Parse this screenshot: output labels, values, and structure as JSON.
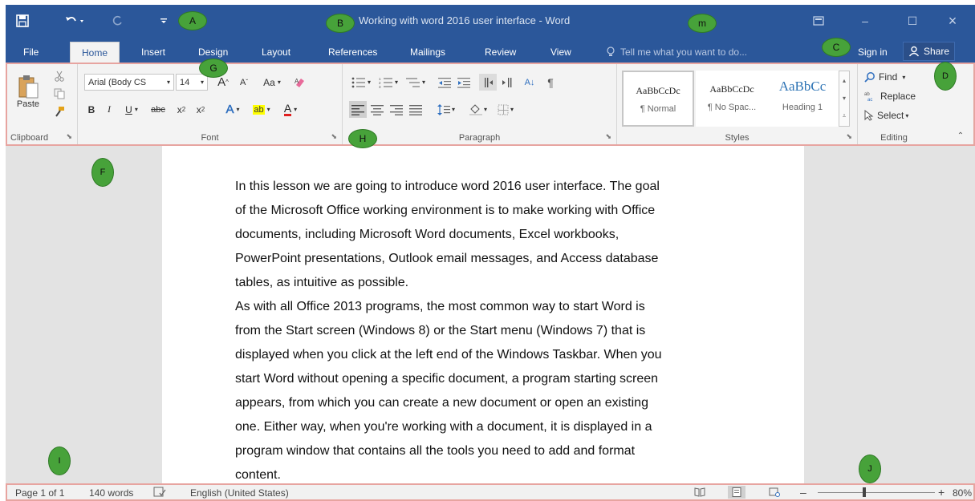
{
  "titlebar": {
    "save_icon": "floppy-disk-icon",
    "undo_icon": "undo-icon",
    "redo_icon": "redo-icon",
    "customize_icon": "customize-quick-access-icon",
    "title": "Working with word 2016 user interface - Word",
    "ribbon_display_icon": "ribbon-display-options-icon",
    "minimize": "–",
    "maximize": "☐",
    "close": "×"
  },
  "tabs": {
    "file": "File",
    "home": "Home",
    "insert": "Insert",
    "design": "Design",
    "layout": "Layout",
    "references": "References",
    "mailings": "Mailings",
    "review": "Review",
    "view": "View"
  },
  "tell_me": {
    "icon": "lightbulb-icon",
    "placeholder": "Tell me what you want to do..."
  },
  "account": {
    "sign_in": "Sign in",
    "share": "Share",
    "share_icon": "person-icon"
  },
  "ribbon": {
    "clipboard": {
      "label": "Clipboard",
      "paste": "Paste",
      "paste_icon": "clipboard-icon",
      "cut_icon": "scissors-icon",
      "copy_icon": "copy-icon",
      "format_painter_icon": "paintbrush-icon"
    },
    "font": {
      "label": "Font",
      "font_name": "Arial (Body CS",
      "font_size": "14",
      "grow": "A",
      "shrink": "A",
      "change_case": "Aa",
      "bold": "B",
      "italic": "I",
      "underline": "U",
      "strikethrough": "abc",
      "subscript": "x",
      "superscript": "x",
      "text_effects": "A",
      "highlight": "ab",
      "font_color": "A"
    },
    "paragraph": {
      "label": "Paragraph",
      "sort": "A↓",
      "pilcrow": "¶"
    },
    "styles": {
      "label": "Styles",
      "items": [
        {
          "sample": "AaBbCcDc",
          "name": "¶ Normal"
        },
        {
          "sample": "AaBbCcDc",
          "name": "¶ No Spac..."
        },
        {
          "sample": "AaBbCc",
          "name": "Heading 1"
        }
      ]
    },
    "editing": {
      "label": "Editing",
      "find": "Find",
      "replace": "Replace",
      "select": "Select",
      "find_icon": "magnifier-icon",
      "replace_icon": "replace-icon",
      "select_icon": "cursor-arrow-icon"
    }
  },
  "document": {
    "lines": [
      "In this lesson we are going to introduce word 2016 user interface. The goal",
      "of the Microsoft Office working environment is to make working with Office",
      "documents, including Microsoft Word documents, Excel workbooks,",
      "PowerPoint presentations, Outlook email messages, and Access database",
      "tables, as intuitive as possible.",
      "As with all Office 2013 programs, the most common way to start Word is",
      "from the Start screen (Windows 8) or the Start menu (Windows 7) that is",
      "displayed when you click at the left end of the Windows Taskbar. When you",
      "start Word without opening a specific document, a program starting screen",
      "appears, from which you can create a new document or open an existing",
      "one. Either way, when you're working with a document, it is displayed in a",
      "program window that contains all the tools you need to add and format",
      "content."
    ]
  },
  "statusbar": {
    "page": "Page 1 of 1",
    "words": "140 words",
    "proofing_icon": "proofing-book-icon",
    "language": "English (United States)",
    "read_mode_icon": "read-mode-icon",
    "print_layout_icon": "print-layout-icon",
    "web_layout_icon": "web-layout-icon",
    "zoom_out": "–",
    "zoom_in": "+",
    "zoom": "80%",
    "zoom_level_percent": 80
  },
  "callouts": {
    "a": "A",
    "b": "B",
    "m": "m",
    "c": "C",
    "d": "D",
    "g": "G",
    "h": "H",
    "f": "F",
    "i": "I",
    "j": "J"
  }
}
